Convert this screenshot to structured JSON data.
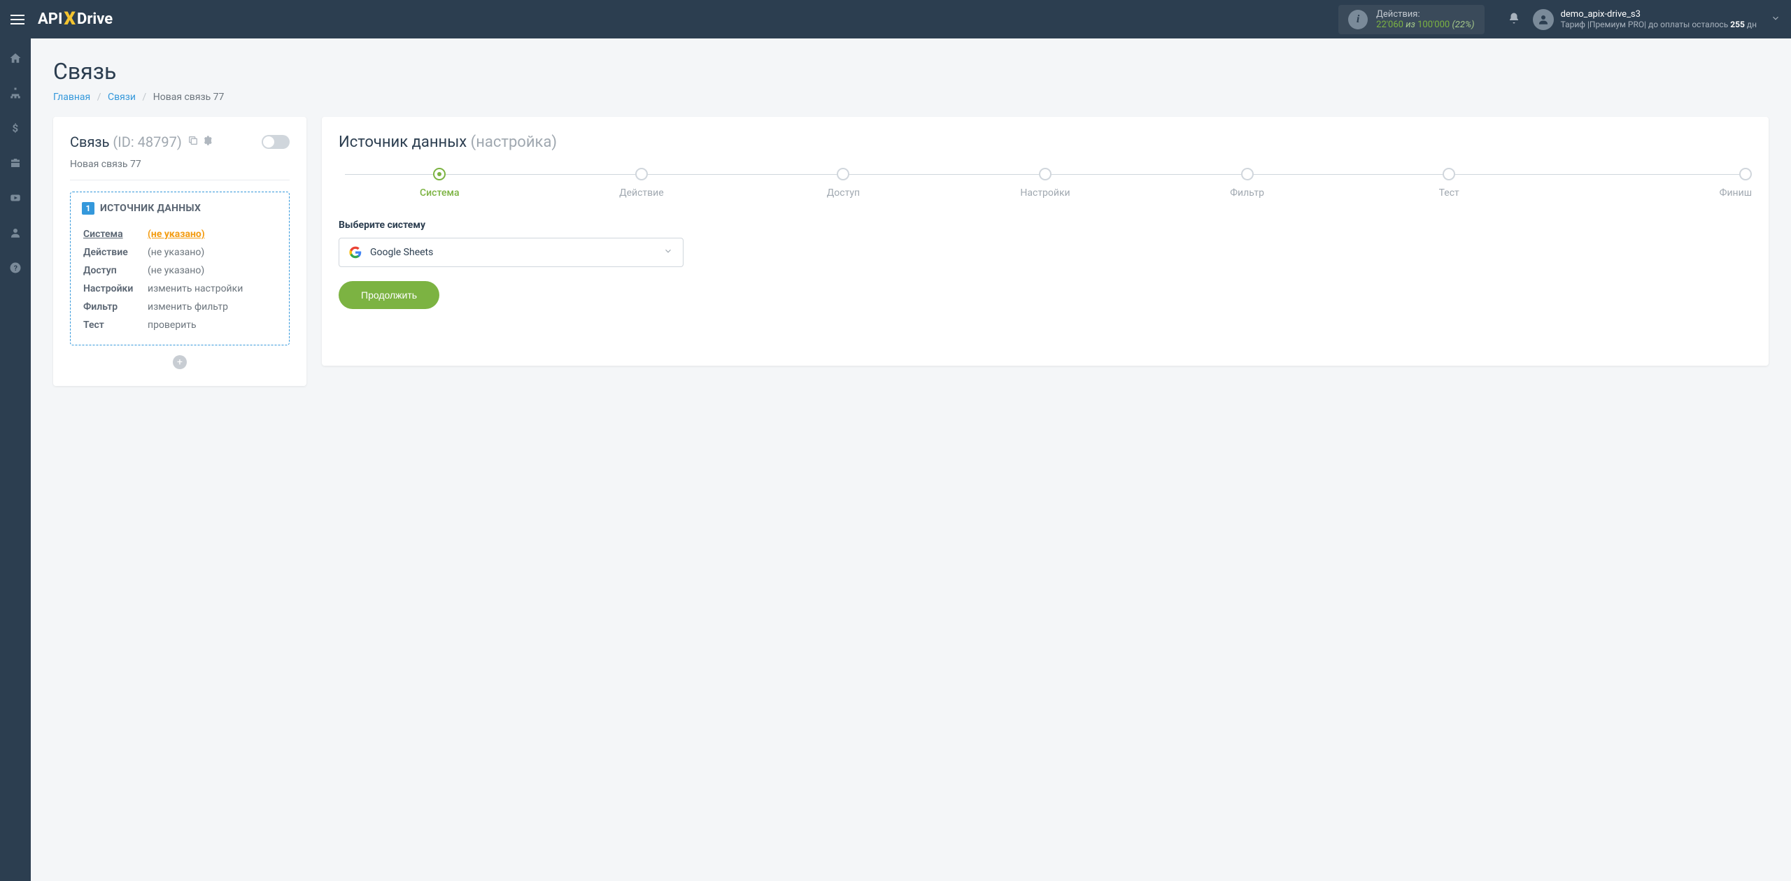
{
  "header": {
    "logo_api": "API",
    "logo_drive": "Drive",
    "actions_label": "Действия:",
    "actions_current": "22'060",
    "actions_of": "из",
    "actions_total": "100'000",
    "actions_pct": "(22%)",
    "username": "demo_apix-drive_s3",
    "tariff_prefix": "Тариф |Премиум PRO| до оплаты осталось ",
    "tariff_days": "255",
    "tariff_suffix": " дн"
  },
  "page": {
    "title": "Связь",
    "breadcrumb_home": "Главная",
    "breadcrumb_links": "Связи",
    "breadcrumb_current": "Новая связь 77"
  },
  "conn": {
    "title": "Связь",
    "id_label": "(ID: 48797)",
    "name": "Новая связь 77",
    "source_badge": "1",
    "source_title": "ИСТОЧНИК ДАННЫХ",
    "rows": [
      {
        "label": "Система",
        "value": "(не указано)",
        "active": true
      },
      {
        "label": "Действие",
        "value": "(не указано)"
      },
      {
        "label": "Доступ",
        "value": "(не указано)"
      },
      {
        "label": "Настройки",
        "value": "изменить настройки"
      },
      {
        "label": "Фильтр",
        "value": "изменить фильтр"
      },
      {
        "label": "Тест",
        "value": "проверить"
      }
    ]
  },
  "panel": {
    "title": "Источник данных",
    "subtitle": "(настройка)",
    "steps": [
      "Система",
      "Действие",
      "Доступ",
      "Настройки",
      "Фильтр",
      "Тест",
      "Финиш"
    ],
    "field_label": "Выберите систему",
    "select_value": "Google Sheets",
    "button_label": "Продолжить"
  }
}
